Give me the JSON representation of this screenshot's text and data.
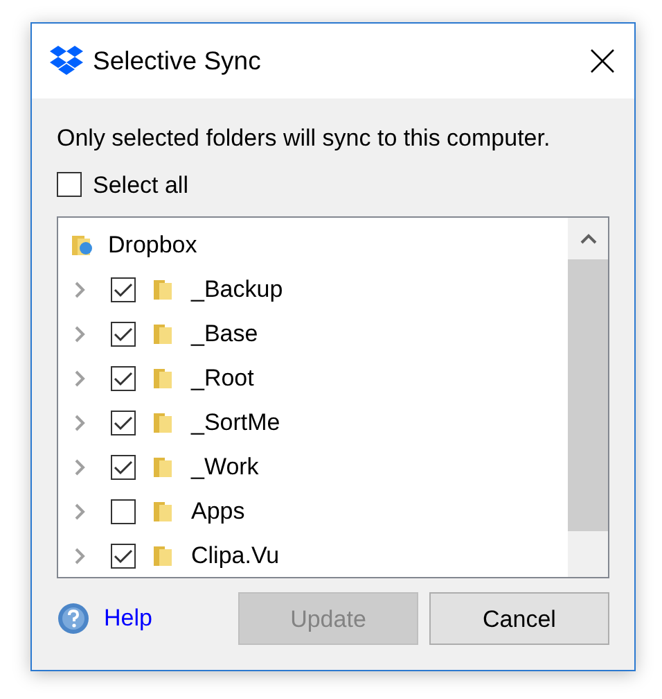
{
  "window": {
    "title": "Selective Sync"
  },
  "instruction": "Only selected folders will sync to this computer.",
  "select_all": {
    "label": "Select all",
    "checked": false
  },
  "tree": {
    "root": {
      "label": "Dropbox"
    },
    "children": [
      {
        "label": "_Backup",
        "checked": true
      },
      {
        "label": "_Base",
        "checked": true
      },
      {
        "label": "_Root",
        "checked": true
      },
      {
        "label": "_SortMe",
        "checked": true
      },
      {
        "label": "_Work",
        "checked": true
      },
      {
        "label": "Apps",
        "checked": false
      },
      {
        "label": "Clipa.Vu",
        "checked": true
      }
    ]
  },
  "help_link": "Help",
  "buttons": [
    {
      "label": "Update",
      "disabled": true
    },
    {
      "label": "Cancel",
      "disabled": false
    }
  ]
}
